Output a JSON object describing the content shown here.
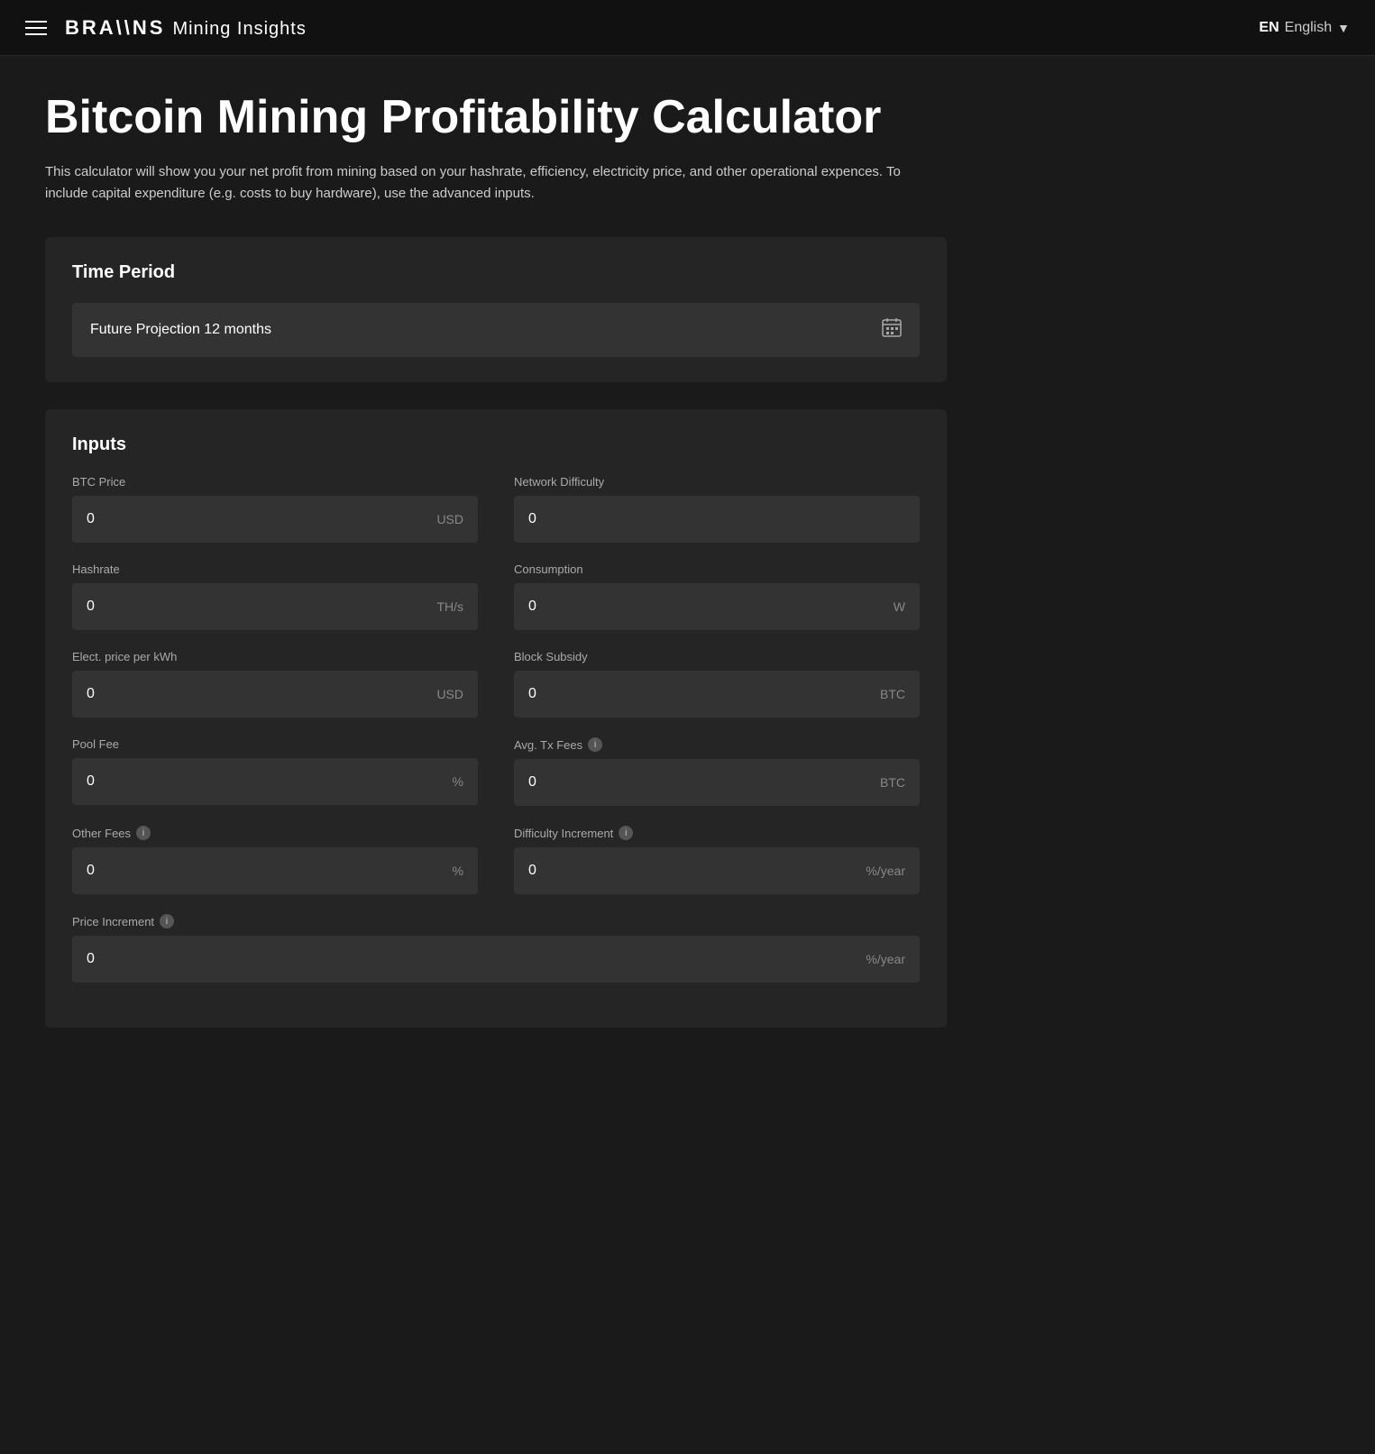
{
  "navbar": {
    "menu_icon": "hamburger-menu",
    "brand": "BRA\\\\NS",
    "subtitle": "Mining Insights",
    "lang_code": "EN",
    "lang_label": "English",
    "chevron": "▼"
  },
  "page": {
    "title": "Bitcoin Mining Profitability Calculator",
    "description": "This calculator will show you your net profit from mining based on your hashrate, efficiency, electricity price, and other operational expences. To include capital expenditure (e.g. costs to buy hardware), use the advanced inputs."
  },
  "time_period": {
    "section_title": "Time Period",
    "selected_value": "Future Projection 12 months",
    "calendar_icon": "📅"
  },
  "inputs": {
    "section_title": "Inputs",
    "fields": [
      {
        "id": "btc-price",
        "label": "BTC Price",
        "value": "0",
        "unit": "USD",
        "has_info": false,
        "full_width": false
      },
      {
        "id": "network-difficulty",
        "label": "Network Difficulty",
        "value": "0",
        "unit": "",
        "has_info": false,
        "full_width": false
      },
      {
        "id": "hashrate",
        "label": "Hashrate",
        "value": "0",
        "unit": "TH/s",
        "has_info": false,
        "full_width": false
      },
      {
        "id": "consumption",
        "label": "Consumption",
        "value": "0",
        "unit": "W",
        "has_info": false,
        "full_width": false
      },
      {
        "id": "elect-price",
        "label": "Elect. price per kWh",
        "value": "0",
        "unit": "USD",
        "has_info": false,
        "full_width": false
      },
      {
        "id": "block-subsidy",
        "label": "Block Subsidy",
        "value": "0",
        "unit": "BTC",
        "has_info": false,
        "full_width": false
      },
      {
        "id": "pool-fee",
        "label": "Pool Fee",
        "value": "0",
        "unit": "%",
        "has_info": false,
        "full_width": false
      },
      {
        "id": "avg-tx-fees",
        "label": "Avg. Tx Fees",
        "value": "0",
        "unit": "BTC",
        "has_info": true,
        "full_width": false
      },
      {
        "id": "other-fees",
        "label": "Other Fees",
        "value": "0",
        "unit": "%",
        "has_info": true,
        "full_width": false
      },
      {
        "id": "difficulty-increment",
        "label": "Difficulty Increment",
        "value": "0",
        "unit": "%/year",
        "has_info": true,
        "full_width": false
      },
      {
        "id": "price-increment",
        "label": "Price Increment",
        "value": "0",
        "unit": "%/year",
        "has_info": true,
        "full_width": true
      }
    ],
    "info_tooltip": "ⓘ"
  }
}
